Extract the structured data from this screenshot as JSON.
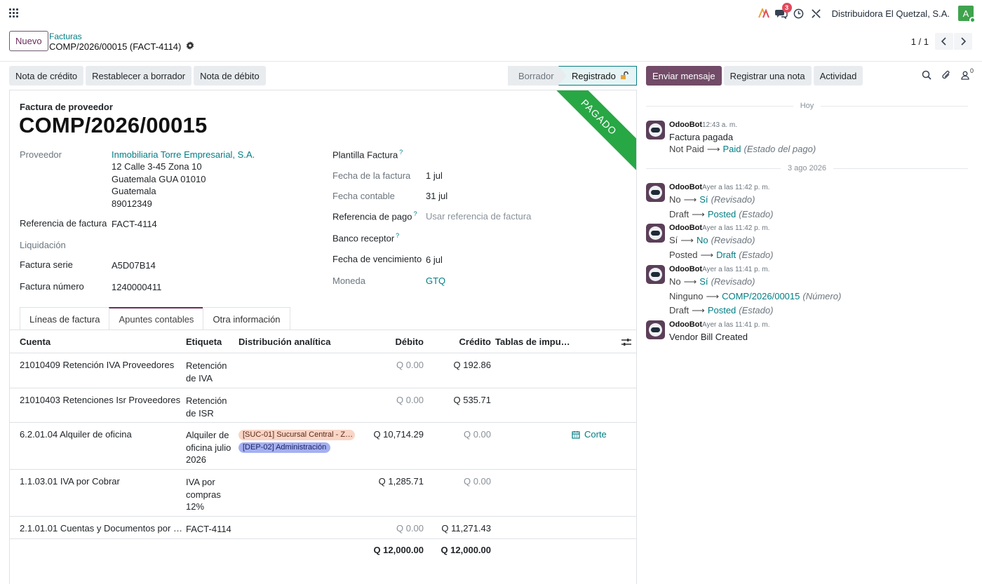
{
  "navbar": {
    "company": "Distribuidora El Quetzal, S.A.",
    "chat_badge": "3",
    "avatar_letter": "A",
    "icons": [
      "apps-icon",
      "ai-icon",
      "chat-icon",
      "clock-icon",
      "tools-icon"
    ]
  },
  "control": {
    "new_button": "Nuevo",
    "breadcrumb": "Facturas",
    "record": "COMP/2026/00015 (FACT-4114)",
    "pager": "1 / 1"
  },
  "actions": {
    "credit_note": "Nota de crédito",
    "reset_draft": "Restablecer a borrador",
    "debit_note": "Nota de débito"
  },
  "status": {
    "draft": "Borrador",
    "posted": "Registrado"
  },
  "form": {
    "ribbon": "PAGADO",
    "doc_type": "Factura de proveedor",
    "doc_name": "COMP/2026/00015",
    "vendor_label": "Proveedor",
    "vendor_name": "Inmobiliaria Torre Empresarial, S.A.",
    "vendor_addr1": "12 Calle 3-45 Zona 10",
    "vendor_addr2": "Guatemala GUA 01010",
    "vendor_addr3": "Guatemala",
    "vendor_addr4": "89012349",
    "ref_label": "Referencia de factura",
    "ref_value": "FACT-4114",
    "liq_label": "Liquidación",
    "serie_label": "Factura serie",
    "serie_value": "A5D07B14",
    "numero_label": "Factura número",
    "numero_value": "1240000411",
    "template_label": "Plantilla Factura",
    "invoice_date_label": "Fecha de la factura",
    "invoice_date_value": "1 jul",
    "acc_date_label": "Fecha contable",
    "acc_date_value": "31 jul",
    "pay_ref_label": "Referencia de pago",
    "pay_ref_placeholder": "Usar referencia de factura",
    "bank_label": "Banco receptor",
    "due_label": "Fecha de vencimiento",
    "due_value": "6 jul",
    "currency_label": "Moneda",
    "currency_value": "GTQ",
    "tooltip_mark": "?"
  },
  "tabs": [
    "Líneas de factura",
    "Apuntes contables",
    "Otra información"
  ],
  "table": {
    "headers": {
      "account": "Cuenta",
      "label": "Etiqueta",
      "analytic": "Distribución analítica",
      "debit": "Débito",
      "credit": "Crédito",
      "taxes": "Tablas de impu…"
    },
    "rows": [
      {
        "account": "21010409 Retención IVA Proveedores",
        "label": "Retención de IVA",
        "debit": "Q 0.00",
        "credit": "Q 192.86"
      },
      {
        "account": "21010403 Retenciones Isr Proveedores",
        "label": "Retención de ISR",
        "debit": "Q 0.00",
        "credit": "Q 535.71"
      },
      {
        "account": "6.2.01.04 Alquiler de oficina",
        "label": "Alquiler de oficina julio 2026",
        "debit": "Q 10,714.29",
        "credit": "Q 0.00",
        "tag1": "[SUC-01] Sucursal Central - Z…",
        "tag2": "[DEP-02] Administración",
        "tax_grid": "Corte"
      },
      {
        "account": "1.1.03.01 IVA por Cobrar",
        "label": "IVA por compras 12%",
        "debit": "Q 1,285.71",
        "credit": "Q 0.00"
      },
      {
        "account": "2.1.01.01 Cuentas y Documentos por Pa…",
        "label": "FACT-4114",
        "debit": "Q 0.00",
        "credit": "Q 11,271.43"
      }
    ],
    "total_debit": "Q 12,000.00",
    "total_credit": "Q 12,000.00"
  },
  "chatter": {
    "send_message": "Enviar mensaje",
    "log_note": "Registrar una nota",
    "activity": "Actividad",
    "followers_count": "0",
    "sep_today": "Hoy",
    "sep_date": "3 ago 2026",
    "author": "OdooBot",
    "messages": [
      {
        "time": "12:43 a. m.",
        "body": "Factura pagada",
        "old": "Not Paid",
        "new": "Paid",
        "field": "(Estado del pago)"
      },
      {
        "time": "Ayer a las 11:42 p. m.",
        "old1": "No",
        "new1": "Sí",
        "field1": "(Revisado)",
        "old2": "Draft",
        "new2": "Posted",
        "field2": "(Estado)"
      },
      {
        "time": "Ayer a las 11:42 p. m.",
        "old1": "Sí",
        "new1": "No",
        "field1": "(Revisado)",
        "old2": "Posted",
        "new2": "Draft",
        "field2": "(Estado)"
      },
      {
        "time": "Ayer a las 11:41 p. m.",
        "old1": "No",
        "new1": "Sí",
        "field1": "(Revisado)",
        "old2": "Ninguno",
        "new2": "COMP/2026/00015",
        "field2": "(Número)",
        "old3": "Draft",
        "new3": "Posted",
        "field3": "(Estado)"
      },
      {
        "time": "Ayer a las 11:41 p. m.",
        "body": "Vendor Bill Created"
      }
    ]
  },
  "colors": {
    "brand": "#714b67",
    "link": "#017e84",
    "ribbon": "#28a745"
  }
}
